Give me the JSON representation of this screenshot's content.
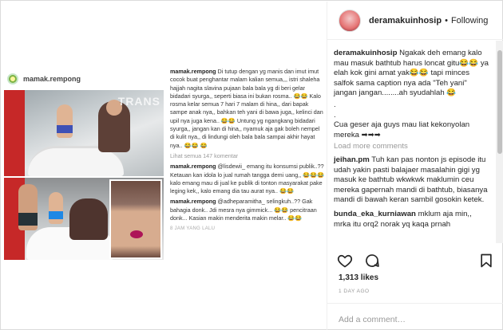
{
  "screenshot": {
    "username": "mamak.rempong",
    "photo_watermark": "TRANS",
    "comments": [
      {
        "user": "mamak.rempong",
        "text": "Di tutup dengan yg manis dan imut imut cocok buat penghantar malam kalian semua,,, istri shaleha hajjah nagita slavina pujaan bala bala yg di beri gelar bidadari syurga,, seperti biasa ini bukan rosma.. 😂😂 Kalo rosma kelar semua 7 hari 7 malam di hina,, dari bapak sampe anak nya,, bahkan teh yani di bawa juga,, kelinci dan upil nya juga kena.. 😂😂 Untung yg ngangkang bidadari syurga,, jangan kan di hina,, nyamuk aja gak boleh nempel di kulit nya,, di lindungi oleh bala bala sampai akhir hayat nya.. 😂😂 😂"
      },
      {
        "user": "mamak.rempong",
        "text": "@lisdewii_ emang itu konsumsi publik..?? Ketauan kan idola lo jual rumah tangga demi uang,, 😂😂😂 kalo emang mau di jual ke publik di tonton masyarakat pake leging kek,, kalo emang dia tau aurat nya.. 😂😂"
      },
      {
        "user": "mamak.rempong",
        "text": "@adheparamitha_ selingkuh..?? Gak bahagia donk.. Jdi mesra nya gimmick... 😂😂 pencitraan donk... Kasian makin menderita makin melar.. 😂😂"
      }
    ],
    "view_all": "Lihat semua 147 komentar",
    "time": "8 JAM YANG LALU"
  },
  "post": {
    "username": "deramakuinhosip",
    "follow_status": "Following",
    "caption_user": "deramakuinhosip",
    "caption_text": "Ngakak deh emang kalo mau masuk bathtub harus loncat gitu😂😂 ya elah kok gini amat yak😂😂 tapi minces salfok sama caption nya ada \"Teh yani\" jangan jangan........ah syudahlah 😂",
    "caption_dots": [
      ".",
      "."
    ],
    "caption_end": "Cua geser aja guys mau liat kekonyolan mereka ➡➡➡",
    "load_more": "Load more comments",
    "comments": [
      {
        "user": "jeihan.pm",
        "text": "Tuh kan pas nonton js episode itu udah yakin pasti balajaer masalahin gigi yg masuk ke bathtub wkwkwk maklumin ceu mereka gapernah mandi di bathtub, biasanya mandi di bawah keran sambil gosokin ketek."
      },
      {
        "user": "bunda_eka_kurniawan",
        "text": "mklum aja min,, mrka itu orq2 norak yq kaqa prnah"
      }
    ],
    "likes": "1,313 likes",
    "time_ago": "1 DAY AGO",
    "add_comment_placeholder": "Add a comment…"
  }
}
